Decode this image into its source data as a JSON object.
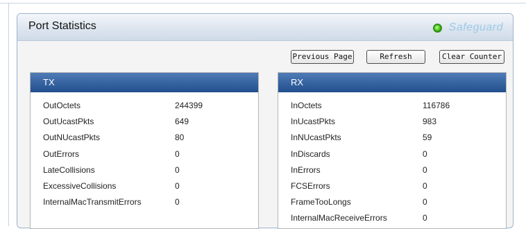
{
  "panel": {
    "title": "Port Statistics",
    "safeguard_label": "Safeguard"
  },
  "buttons": {
    "previous_page": "Previous Page",
    "refresh": "Refresh",
    "clear_counter": "Clear Counter"
  },
  "tx": {
    "header": "TX",
    "rows": [
      {
        "label": "OutOctets",
        "value": "244399"
      },
      {
        "label": "OutUcastPkts",
        "value": "649"
      },
      {
        "label": "OutNUcastPkts",
        "value": "80"
      },
      {
        "label": "OutErrors",
        "value": "0"
      },
      {
        "label": "LateCollisions",
        "value": "0"
      },
      {
        "label": "ExcessiveCollisions",
        "value": "0"
      },
      {
        "label": "InternalMacTransmitErrors",
        "value": "0"
      }
    ]
  },
  "rx": {
    "header": "RX",
    "rows": [
      {
        "label": "InOctets",
        "value": "116786"
      },
      {
        "label": "InUcastPkts",
        "value": "983"
      },
      {
        "label": "InNUcastPkts",
        "value": "59"
      },
      {
        "label": "InDiscards",
        "value": "0"
      },
      {
        "label": "InErrors",
        "value": "0"
      },
      {
        "label": "FCSErrors",
        "value": "0"
      },
      {
        "label": "FrameTooLongs",
        "value": "0"
      },
      {
        "label": "InternalMacReceiveErrors",
        "value": "0"
      }
    ]
  },
  "colors": {
    "table_header": "#2f5f9f",
    "safeguard_indicator": "#45c21a",
    "safeguard_text": "#9ec9e8"
  }
}
